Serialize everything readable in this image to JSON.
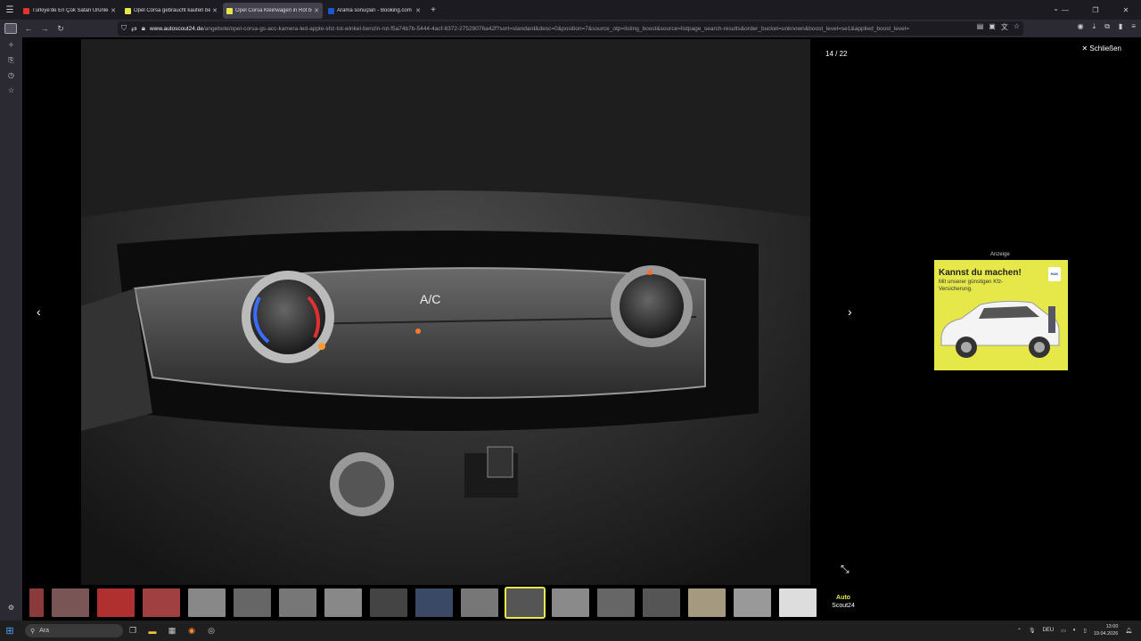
{
  "browser": {
    "tabs": [
      {
        "title": "Türkiye'de En Çok Satan Ürünle",
        "color": "#e3342f",
        "active": false
      },
      {
        "title": "Opel Corsa gebraucht kaufen bei",
        "color": "#e8e84a",
        "active": false
      },
      {
        "title": "Opel Corsa Kleinwagen in Rot bei",
        "color": "#e8e84a",
        "active": true
      },
      {
        "title": "Arama sonuçları - Booking.com",
        "color": "#1e57c9",
        "active": false
      }
    ],
    "url_host": "www.autoscout24.de",
    "url_path": "/angebote/opel-corsa-gs-acc-kamera-led-apple-shz-tot-winkel-benzin-rot-f5a74b7b-5444-4acf-8372-27529076a42f?sort=standard&desc=0&position=7&source_otp=listing_boost&source=listpage_search-results&order_bucket=unknown&boost_level=se1&applied_boost_level="
  },
  "gallery": {
    "counter": "14 / 22",
    "close_label": "Schließen",
    "ad_label": "Anzeige",
    "ad": {
      "headline": "Kannst du machen!",
      "subtext": "Mit unserer günstigen Kfz-Versicherung.",
      "logo": "HUK"
    },
    "thumbnail_count": 18,
    "selected_thumbnail": 11,
    "last_thumb": {
      "line1": "Auto",
      "line2": "Scout24"
    }
  },
  "taskbar": {
    "search_placeholder": "Ara",
    "lang": "DEU",
    "time": "13:00",
    "date": "19.04.2026"
  }
}
